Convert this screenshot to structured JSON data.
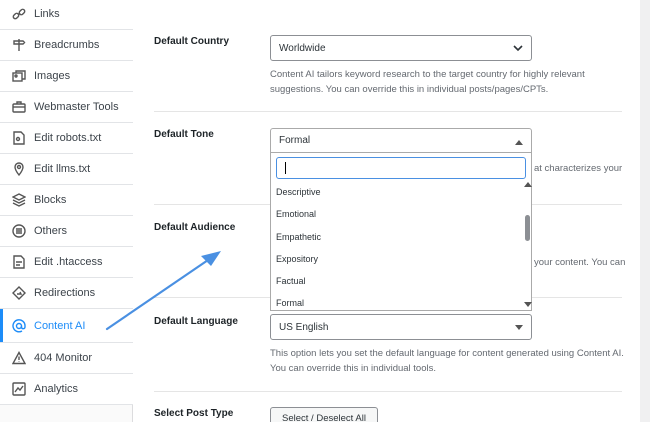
{
  "sidebar": {
    "items": [
      {
        "label": "Links",
        "icon": "link-icon"
      },
      {
        "label": "Breadcrumbs",
        "icon": "signpost-icon"
      },
      {
        "label": "Images",
        "icon": "images-icon"
      },
      {
        "label": "Webmaster Tools",
        "icon": "toolbox-icon"
      },
      {
        "label": "Edit robots.txt",
        "icon": "robots-file-icon"
      },
      {
        "label": "Edit llms.txt",
        "icon": "location-pin-icon"
      },
      {
        "label": "Blocks",
        "icon": "blocks-icon"
      },
      {
        "label": "Others",
        "icon": "circle-menu-icon"
      },
      {
        "label": "Edit .htaccess",
        "icon": "file-edit-icon"
      },
      {
        "label": "Redirections",
        "icon": "redirect-icon"
      },
      {
        "label": "Content AI",
        "icon": "at-sign-icon",
        "active": true
      },
      {
        "label": "404 Monitor",
        "icon": "warning-icon"
      },
      {
        "label": "Analytics",
        "icon": "chart-icon"
      }
    ]
  },
  "settings": {
    "country": {
      "label": "Default Country",
      "value": "Worldwide",
      "description_1": "Content AI tailors keyword research to the target country for highly relevant",
      "description_2": "suggestions. You can override this in individual posts/pages/CPTs."
    },
    "tone": {
      "label": "Default Tone",
      "value": "Formal",
      "description_fragment": "at characterizes your"
    },
    "audience": {
      "label": "Default Audience",
      "description_fragment": "your content. You can"
    },
    "language": {
      "label": "Default Language",
      "value": "US English",
      "description_1": "This option lets you set the default language for content generated using Content AI.",
      "description_2": "You can override this in individual tools."
    },
    "post_type": {
      "label": "Select Post Type",
      "button": "Select / Deselect All"
    }
  },
  "tone_dropdown": {
    "search_value": "",
    "options": [
      "Descriptive",
      "Emotional",
      "Empathetic",
      "Expository",
      "Factual",
      "Formal"
    ]
  },
  "colors": {
    "accent": "#1d8cf8",
    "annotation_arrow": "#4a90e2"
  }
}
